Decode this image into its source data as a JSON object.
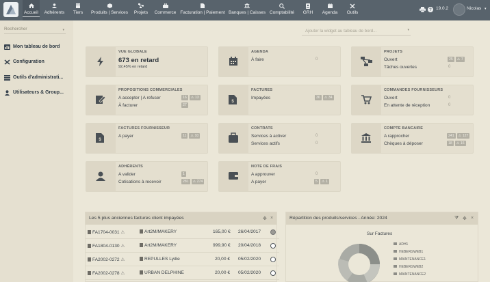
{
  "topbar": {
    "logo_icon": "app-logo",
    "nav": [
      {
        "label": "Accueil",
        "icon": "home-icon",
        "active": true
      },
      {
        "label": "Adhérents",
        "icon": "member-icon"
      },
      {
        "label": "Tiers",
        "icon": "building-icon"
      },
      {
        "label": "Produits | Services",
        "icon": "cube-icon"
      },
      {
        "label": "Projets",
        "icon": "project-icon"
      },
      {
        "label": "Commerce",
        "icon": "briefcase-icon"
      },
      {
        "label": "Facturation | Paiement",
        "icon": "invoice-icon"
      },
      {
        "label": "Banques | Caisses",
        "icon": "bank-icon"
      },
      {
        "label": "Comptabilité",
        "icon": "search-dollar-icon"
      },
      {
        "label": "GRH",
        "icon": "id-card-icon"
      },
      {
        "label": "Agenda",
        "icon": "calendar-icon"
      },
      {
        "label": "Outils",
        "icon": "tools-icon"
      }
    ],
    "version": "19.0.2",
    "user_name": "Nicolas",
    "user_caret": "▾"
  },
  "sidebar": {
    "search_placeholder": "Rechercher",
    "search_caret": "▾",
    "items": [
      {
        "label": "Mon tableau de bord",
        "icon": "dashboard-icon"
      },
      {
        "label": "Configuration",
        "icon": "wrench-icon"
      },
      {
        "label": "Outils d'administrati...",
        "icon": "server-icon"
      },
      {
        "label": "Utilisateurs & Group...",
        "icon": "user-icon"
      }
    ]
  },
  "main": {
    "add_widget_placeholder": "Ajouter la widget au tableau de bord...",
    "add_widget_caret": "▾",
    "boxes": [
      {
        "title": "VUE GLOBALE",
        "big": "673 en retard",
        "pct": "92,45% en retard",
        "icon": "bolt-icon"
      },
      {
        "title": "AGENDA",
        "icon": "calendar-icon",
        "rows": [
          {
            "label": "À faire",
            "count": "0"
          }
        ]
      },
      {
        "title": "PROJETS",
        "icon": "project-icon",
        "rows": [
          {
            "label": "Ouvert",
            "badges": [
              "25",
              "7"
            ]
          },
          {
            "label": "Tâches ouvertes",
            "count": "0"
          }
        ]
      },
      {
        "title": "PROPOSITIONS COMMERCIALES",
        "icon": "proposal-icon",
        "rows": [
          {
            "label": "A accepter | A refuser",
            "badges": [
              "16",
              "13"
            ]
          },
          {
            "label": "À facturer",
            "badges": [
              "27"
            ]
          }
        ]
      },
      {
        "title": "FACTURES",
        "icon": "invoice-icon",
        "rows": [
          {
            "label": "Impayées",
            "badges": [
              "36",
              "34"
            ]
          }
        ]
      },
      {
        "title": "COMMANDES FOURNISSEURS",
        "icon": "cart-icon",
        "rows": [
          {
            "label": "Ouvert",
            "count": "0"
          },
          {
            "label": "En attente de réception",
            "count": "0"
          }
        ]
      },
      {
        "title": "FACTURES FOURNISSEUR",
        "icon": "supplier-invoice-icon",
        "rows": [
          {
            "label": "A payer",
            "badges": [
              "11",
              "10"
            ]
          }
        ]
      },
      {
        "title": "CONTRATS",
        "icon": "contract-icon",
        "rows": [
          {
            "label": "Services à activer",
            "count": "0"
          },
          {
            "label": "Services actifs",
            "count": "0"
          }
        ]
      },
      {
        "title": "COMPTE BANCAIRE",
        "icon": "bank-icon",
        "rows": [
          {
            "label": "A rapprocher",
            "badges": [
              "241",
              "127"
            ]
          },
          {
            "label": "Chèques à déposer",
            "badges": [
              "18",
              "16"
            ]
          }
        ]
      },
      {
        "title": "ADHÉRENTS",
        "icon": "member-icon",
        "rows": [
          {
            "label": "A valider",
            "badges": [
              "1"
            ]
          },
          {
            "label": "Cotisations à recevoir",
            "badges": [
              "281",
              "274"
            ]
          }
        ]
      },
      {
        "title": "NOTE DE FRAIS",
        "icon": "wallet-icon",
        "rows": [
          {
            "label": "A approuver",
            "count": "0"
          },
          {
            "label": "A payer",
            "badges": [
              "5",
              "1"
            ]
          }
        ]
      }
    ],
    "invoices_panel": {
      "title": "Les 5 plus anciennes factures client impayées",
      "move": "✥",
      "close": "×",
      "rows": [
        {
          "ref": "FA1704-0031",
          "warn": true,
          "company": "Art2M/MAKERY",
          "amount": "165,00 €",
          "date": "26/04/2017",
          "checked": true
        },
        {
          "ref": "FA1804-0130",
          "warn": true,
          "company": "Art2M/MAKERY",
          "amount": "999,90 €",
          "date": "20/04/2018",
          "checked": false
        },
        {
          "ref": "FA2002-0272",
          "warn": true,
          "company": "REPULLES Lydie",
          "amount": "20,00 €",
          "date": "05/02/2020",
          "checked": false
        },
        {
          "ref": "FA2002-0278",
          "warn": true,
          "company": "URBAN DELPHINE",
          "amount": "20,00 €",
          "date": "05/02/2020",
          "checked": false
        }
      ]
    },
    "products_panel": {
      "title": "Répartition des produits/services - Année: 2024",
      "filter": "⧩",
      "move": "✥",
      "close": "×",
      "chart_title": "Sur Factures",
      "legend": [
        "ADH1",
        "HEBERGWEB1",
        "MAINTENANCE1",
        "HEBERGWEB2",
        "MAINTENANCE2"
      ]
    }
  }
}
